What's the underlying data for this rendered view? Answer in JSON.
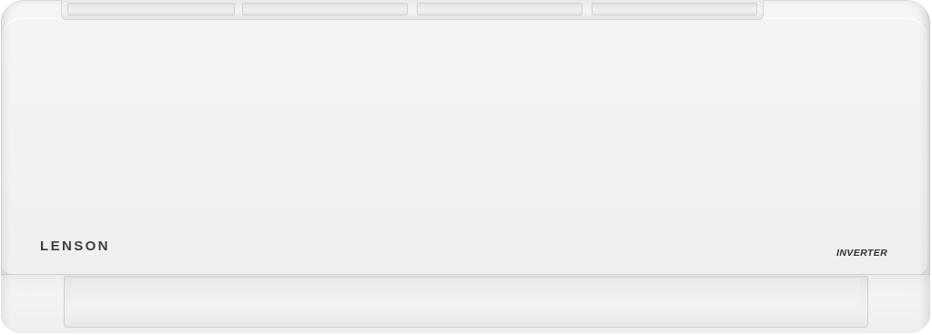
{
  "product": {
    "brand": "LENSON",
    "badge": "INVERTER"
  },
  "colors": {
    "body": "#f2f2f3",
    "brand_text": "#3d4043",
    "badge_text": "#2f3134"
  },
  "icons": [
    "air-conditioner-unit",
    "air-grille",
    "airflow-louver"
  ]
}
